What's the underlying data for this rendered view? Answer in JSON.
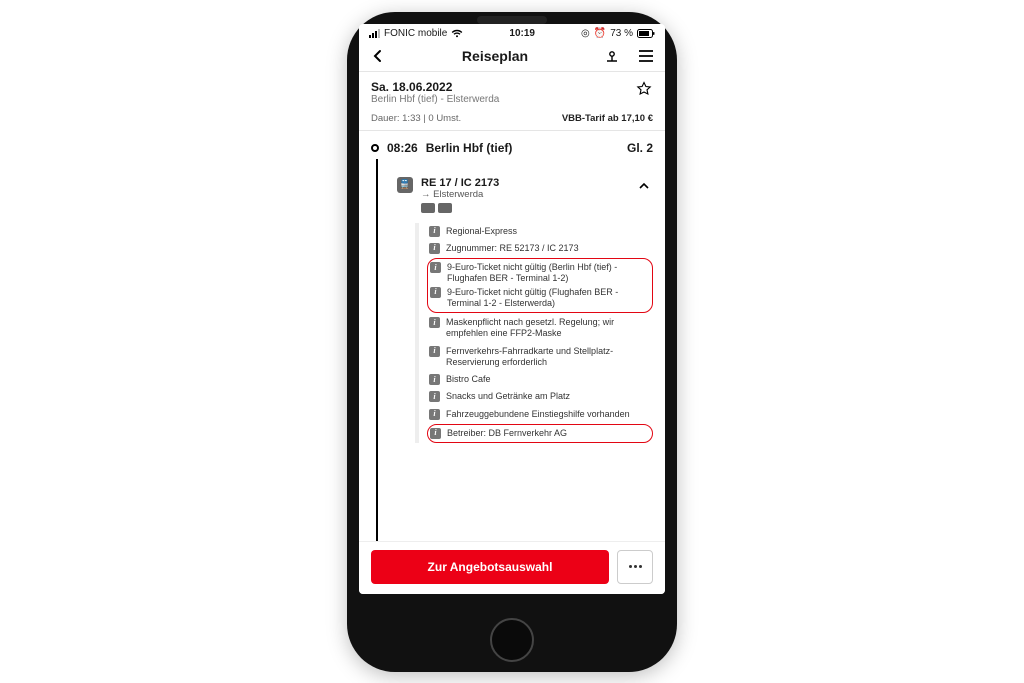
{
  "status": {
    "carrier": "FONIC mobile",
    "time": "10:19",
    "battery": "73 %"
  },
  "nav": {
    "title": "Reiseplan"
  },
  "trip": {
    "date": "Sa. 18.06.2022",
    "route": "Berlin Hbf (tief) - Elsterwerda",
    "duration": "Dauer: 1:33 | 0 Umst.",
    "price": "VBB-Tarif ab 17,10 €"
  },
  "departure": {
    "time": "08:26",
    "station": "Berlin Hbf (tief)",
    "platform": "Gl. 2"
  },
  "train": {
    "name": "RE 17 / IC 2173",
    "dest": "→ Elsterwerda"
  },
  "info": [
    "Regional-Express",
    "Zugnummer: RE 52173 / IC 2173",
    "9-Euro-Ticket nicht gültig (Berlin Hbf (tief) - Flughafen BER - Terminal 1-2)",
    "9-Euro-Ticket nicht gültig (Flughafen BER - Terminal 1-2 - Elsterwerda)",
    "Maskenpflicht nach gesetzl. Regelung; wir empfehlen eine FFP2-Maske",
    "Fernverkehrs-Fahrradkarte und Stellplatz-Reservierung erforderlich",
    "Bistro Cafe",
    "Snacks und Getränke am Platz",
    "Fahrzeuggebundene Einstiegshilfe vorhanden",
    "Betreiber: DB Fernverkehr AG"
  ],
  "cta": {
    "label": "Zur Angebotsauswahl"
  }
}
